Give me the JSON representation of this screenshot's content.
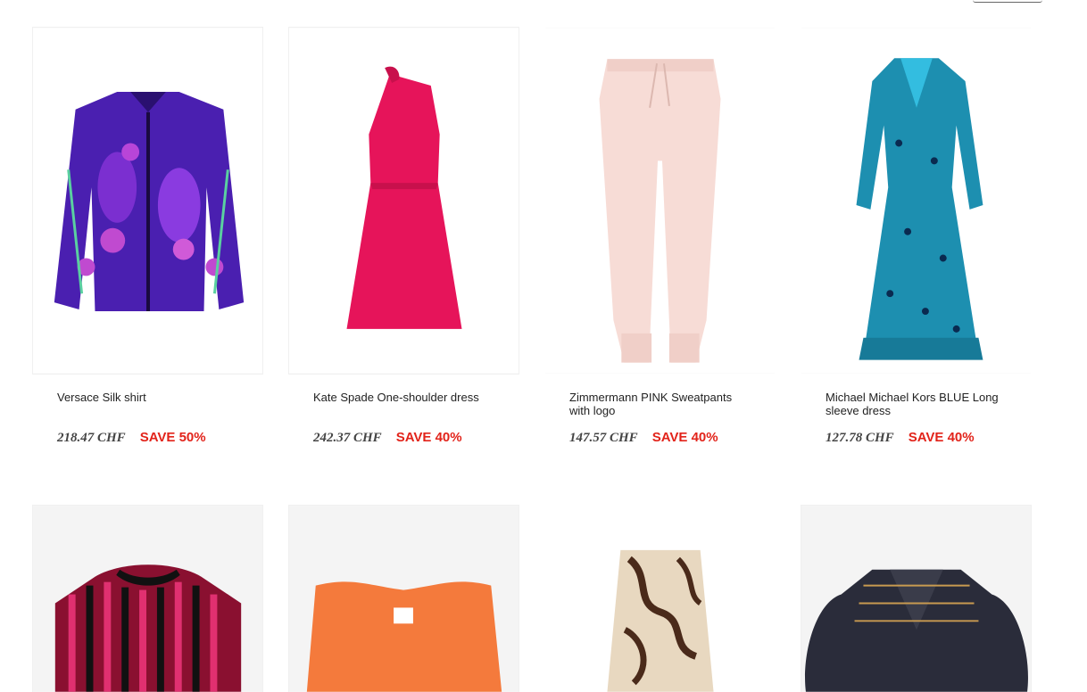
{
  "products": [
    {
      "name": "Versace Silk shirt",
      "price": "218.47 CHF",
      "discount": "SAVE 50%",
      "image": "silk-shirt-image"
    },
    {
      "name": "Kate Spade One-shoulder dress",
      "price": "242.37 CHF",
      "discount": "SAVE 40%",
      "image": "pink-dress-image"
    },
    {
      "name": "Zimmermann PINK Sweatpants with logo",
      "price": "147.57 CHF",
      "discount": "SAVE 40%",
      "image": "sweatpants-image"
    },
    {
      "name": "Michael Michael Kors BLUE Long sleeve dress",
      "price": "127.78 CHF",
      "discount": "SAVE 40%",
      "image": "blue-dress-image"
    }
  ],
  "second_row_images": [
    "striped-sweater-image",
    "orange-tank-image",
    "printed-trousers-image",
    "black-blouse-image"
  ],
  "colors": {
    "save": "#e2231a",
    "price": "#444444"
  }
}
